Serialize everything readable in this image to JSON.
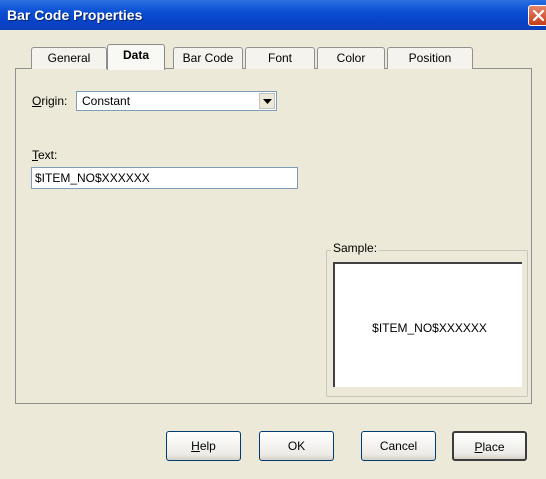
{
  "window": {
    "title": "Bar Code Properties"
  },
  "tabs": [
    {
      "label": "General",
      "active": false
    },
    {
      "label": "Data",
      "active": true
    },
    {
      "label": "Bar Code",
      "active": false
    },
    {
      "label": "Font",
      "active": false
    },
    {
      "label": "Color",
      "active": false
    },
    {
      "label": "Position",
      "active": false
    }
  ],
  "origin": {
    "label": "Origin:",
    "mnemonic": "O",
    "rest": "rigin:",
    "value": "Constant"
  },
  "text_field": {
    "label": "Text:",
    "mnemonic": "T",
    "rest": "ext:",
    "value": "$ITEM_NO$XXXXXX"
  },
  "sample": {
    "label": "Sample:",
    "value": "$ITEM_NO$XXXXXX"
  },
  "buttons": {
    "help": {
      "label": "Help",
      "mnemonic": "H",
      "rest": "elp"
    },
    "ok": {
      "label": "OK"
    },
    "cancel": {
      "label": "Cancel"
    },
    "place": {
      "label": "Place",
      "mnemonic": "P",
      "rest": "lace"
    }
  }
}
